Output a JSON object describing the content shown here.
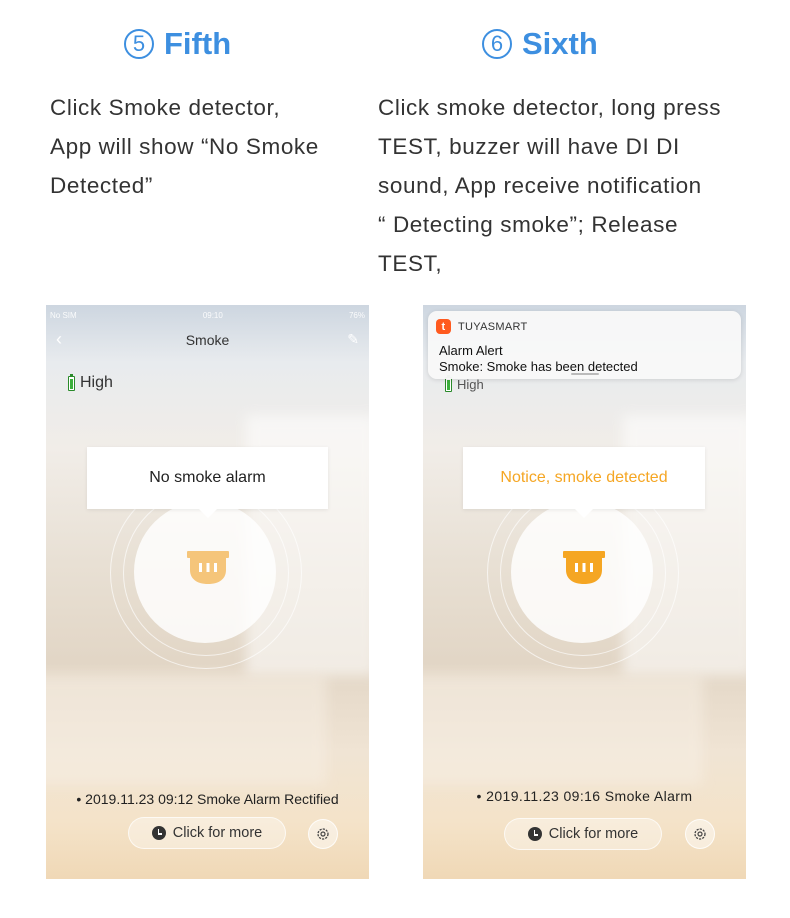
{
  "steps": [
    {
      "number": "5",
      "title": "Fifth",
      "description": "Click Smoke detector,\nApp will show “No Smoke\nDetected”"
    },
    {
      "number": "6",
      "title": "Sixth",
      "description": "Click smoke detector, long press\nTEST, buzzer will have DI DI\nsound, App receive notification\n“ Detecting smoke”; Release\nTEST,"
    }
  ],
  "phone_left": {
    "status": {
      "carrier": "No SIM",
      "time": "09:10",
      "battery": "76%"
    },
    "nav_title": "Smoke",
    "battery_label": "High",
    "bubble_text": "No smoke alarm",
    "history_text": "2019.11.23 09:12 Smoke Alarm Rectified",
    "more_button": "Click for more",
    "icon_color": "#f5c57a",
    "bubble_color": "#222222"
  },
  "phone_right": {
    "notification": {
      "app_name": "TUYASMART",
      "app_icon": "t",
      "title": "Alarm Alert",
      "body": "Smoke: Smoke has been detected"
    },
    "battery_label": "High",
    "bubble_text": "Notice, smoke detected",
    "history_text": "2019.11.23 09:16 Smoke Alarm",
    "more_button": "Click for more",
    "icon_color": "#f5a623",
    "bubble_color": "#f5a623"
  },
  "colors": {
    "accent": "#3d8fe0"
  }
}
